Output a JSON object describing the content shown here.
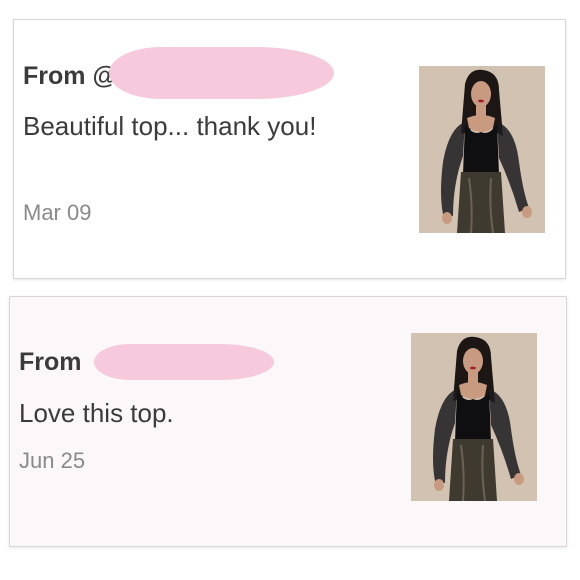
{
  "reviews": [
    {
      "from_label": "From @",
      "message": "Beautiful top... thank you!",
      "date": "Mar 09",
      "product_image": "model-in-black-lace-sleeve-top"
    },
    {
      "from_label": "From",
      "message": "Love this top.",
      "date": "Jun 25",
      "product_image": "model-in-black-lace-sleeve-top"
    }
  ],
  "colors": {
    "redaction": "#f6c9dc",
    "text": "#3b3b3b",
    "date": "#8a8a8a",
    "photo_bg": "#d2c2b1"
  }
}
